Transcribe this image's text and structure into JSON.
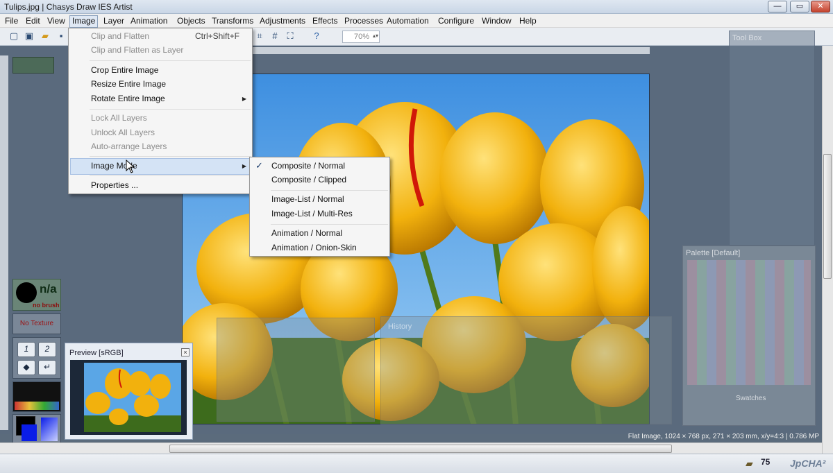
{
  "window": {
    "title": "Tulips.jpg | Chasys Draw IES Artist",
    "controls": [
      "—",
      "▭",
      "✕"
    ]
  },
  "menubar": [
    "File",
    "Edit",
    "View",
    "Image",
    "Layer",
    "Animation",
    "Objects",
    "Transforms",
    "Adjustments",
    "Effects",
    "Processes",
    "Automation",
    "Configure",
    "Window",
    "Help"
  ],
  "toolbar": {
    "zoom": "70%"
  },
  "image_menu": {
    "items": [
      {
        "label": "Clip and Flatten",
        "shortcut": "Ctrl+Shift+F",
        "disabled": true
      },
      {
        "label": "Clip and Flatten as Layer",
        "disabled": true
      },
      {
        "label": "Crop Entire Image"
      },
      {
        "label": "Resize Entire Image"
      },
      {
        "label": "Rotate Entire Image"
      },
      {
        "label": "Lock All Layers",
        "disabled": true
      },
      {
        "label": "Unlock All Layers",
        "disabled": true
      },
      {
        "label": "Auto-arrange Layers",
        "disabled": true
      },
      {
        "label": "Image Mode"
      },
      {
        "label": "Properties ..."
      }
    ]
  },
  "image_mode_submenu": {
    "checked": "Composite / Normal",
    "items": [
      "Composite / Normal",
      "Composite / Clipped",
      "Image-List / Normal",
      "Image-List / Multi-Res",
      "Animation / Normal",
      "Animation / Onion-Skin"
    ]
  },
  "brush": {
    "name": "n/a",
    "status": "no brush"
  },
  "texture": {
    "label": "No Texture"
  },
  "nav_pad": {
    "btn1": "1",
    "btn2": "2"
  },
  "preview": {
    "title": "Preview [sRGB]"
  },
  "panels": {
    "toolbox": "Tool Box",
    "palette": "Palette [Default]",
    "history": "History",
    "swatches": "Swatches"
  },
  "status": {
    "text": "Flat Image, 1024 × 768 px, 271 × 203 mm, x/y=4:3 | 0.786 MP"
  },
  "taskbar": {
    "count": "75",
    "brand": "JpCHA²"
  },
  "colors": {
    "accent": "#3a6ea5",
    "tulip": "#f2b10d",
    "sky": "#4aa3e8"
  }
}
